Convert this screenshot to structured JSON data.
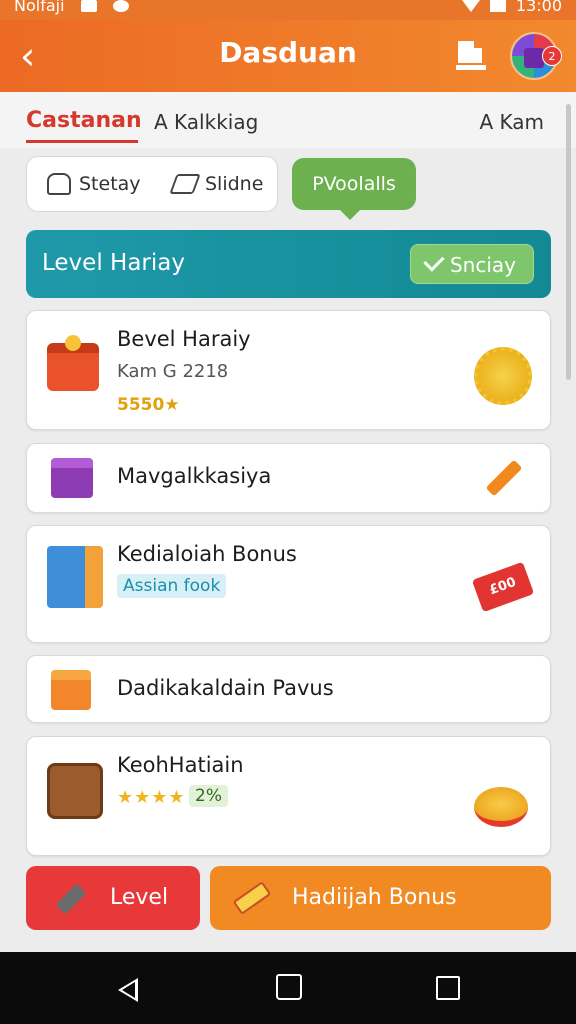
{
  "status_bar": {
    "carrier": "Nolfaji",
    "time": "13:00"
  },
  "header": {
    "title": "Dasduan",
    "notification_count": "2"
  },
  "tabs": [
    {
      "label": "Castanan",
      "active": true
    },
    {
      "label": "A Kalkkiag"
    },
    {
      "label": "A Kam"
    }
  ],
  "filters": {
    "segment": [
      {
        "label": "Stetay",
        "icon": "person-outline-icon"
      },
      {
        "label": "Slidne",
        "icon": "pencil-outline-icon"
      }
    ],
    "pill_label": "PVoolalls"
  },
  "banner": {
    "title": "Level Hariay",
    "button_label": "Snciay"
  },
  "cards": [
    {
      "title": "Bevel Haraiy",
      "subtitle": "Kam G 2218",
      "coins": "5550★",
      "left_icon": "red-gift-chest-icon",
      "right_icon": "gold-coin-icon"
    },
    {
      "title": "Mavgalkkasiya",
      "left_icon": "purple-gift-icon",
      "right_icon": "orange-pencil-icon"
    },
    {
      "title": "Kedialoiah Bonus",
      "tag": "Assian fook",
      "left_icon": "document-icon",
      "right_icon": "red-ticket-icon",
      "ticket_text": "£00"
    },
    {
      "title": "Dadikakaldain Pavus",
      "left_icon": "orange-gift-icon"
    },
    {
      "title": "KeohHatiain",
      "stars": "★★★★",
      "percent": "2%",
      "left_icon": "treasure-chest-icon",
      "right_icon": "coin-stack-icon"
    }
  ],
  "actions": {
    "level_label": "Level",
    "bonus_label": "Hadiijah Bonus"
  },
  "colors": {
    "header": "#ec6a24",
    "banner": "#1f99a9",
    "accent_red": "#e8393a",
    "accent_orange": "#f28a23",
    "green": "#6cb04f"
  }
}
